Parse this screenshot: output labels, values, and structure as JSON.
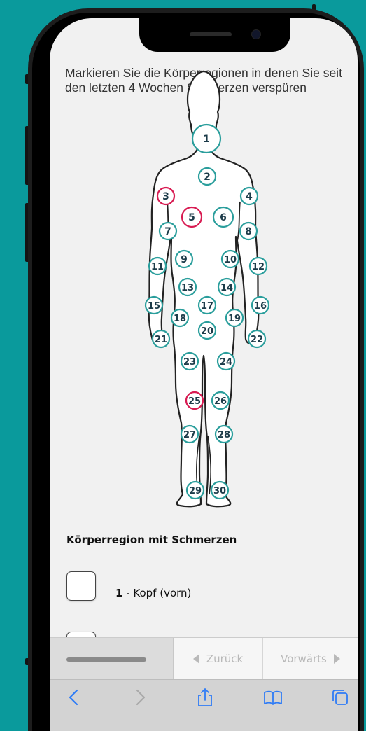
{
  "question": "Markieren Sie die Körperregionen in denen Sie seit den letzten 4 Wochen Schmerzen verspüren",
  "regions": [
    {
      "n": "1",
      "selected": false
    },
    {
      "n": "2",
      "selected": false
    },
    {
      "n": "3",
      "selected": true
    },
    {
      "n": "4",
      "selected": false
    },
    {
      "n": "5",
      "selected": true
    },
    {
      "n": "6",
      "selected": false
    },
    {
      "n": "7",
      "selected": false
    },
    {
      "n": "8",
      "selected": false
    },
    {
      "n": "9",
      "selected": false
    },
    {
      "n": "10",
      "selected": false
    },
    {
      "n": "11",
      "selected": false
    },
    {
      "n": "12",
      "selected": false
    },
    {
      "n": "13",
      "selected": false
    },
    {
      "n": "14",
      "selected": false
    },
    {
      "n": "15",
      "selected": false
    },
    {
      "n": "16",
      "selected": false
    },
    {
      "n": "17",
      "selected": false
    },
    {
      "n": "18",
      "selected": false
    },
    {
      "n": "19",
      "selected": false
    },
    {
      "n": "20",
      "selected": false
    },
    {
      "n": "21",
      "selected": false
    },
    {
      "n": "22",
      "selected": false
    },
    {
      "n": "23",
      "selected": false
    },
    {
      "n": "24",
      "selected": false
    },
    {
      "n": "25",
      "selected": true
    },
    {
      "n": "26",
      "selected": false
    },
    {
      "n": "27",
      "selected": false
    },
    {
      "n": "28",
      "selected": false
    },
    {
      "n": "29",
      "selected": false
    },
    {
      "n": "30",
      "selected": false
    }
  ],
  "section_title": "Körperregion mit Schmerzen",
  "checklist": [
    {
      "number": "1",
      "label": " - Kopf (vorn)",
      "checked": false
    }
  ],
  "nav": {
    "back_label": "Zurück",
    "forward_label": "Vorwärts"
  },
  "colors": {
    "teal": "#2a9e9c",
    "pink": "#d81b52",
    "background": "#0a9a9c"
  },
  "safari_icons": [
    "back-icon",
    "forward-icon",
    "share-icon",
    "bookmarks-icon",
    "tabs-icon"
  ]
}
